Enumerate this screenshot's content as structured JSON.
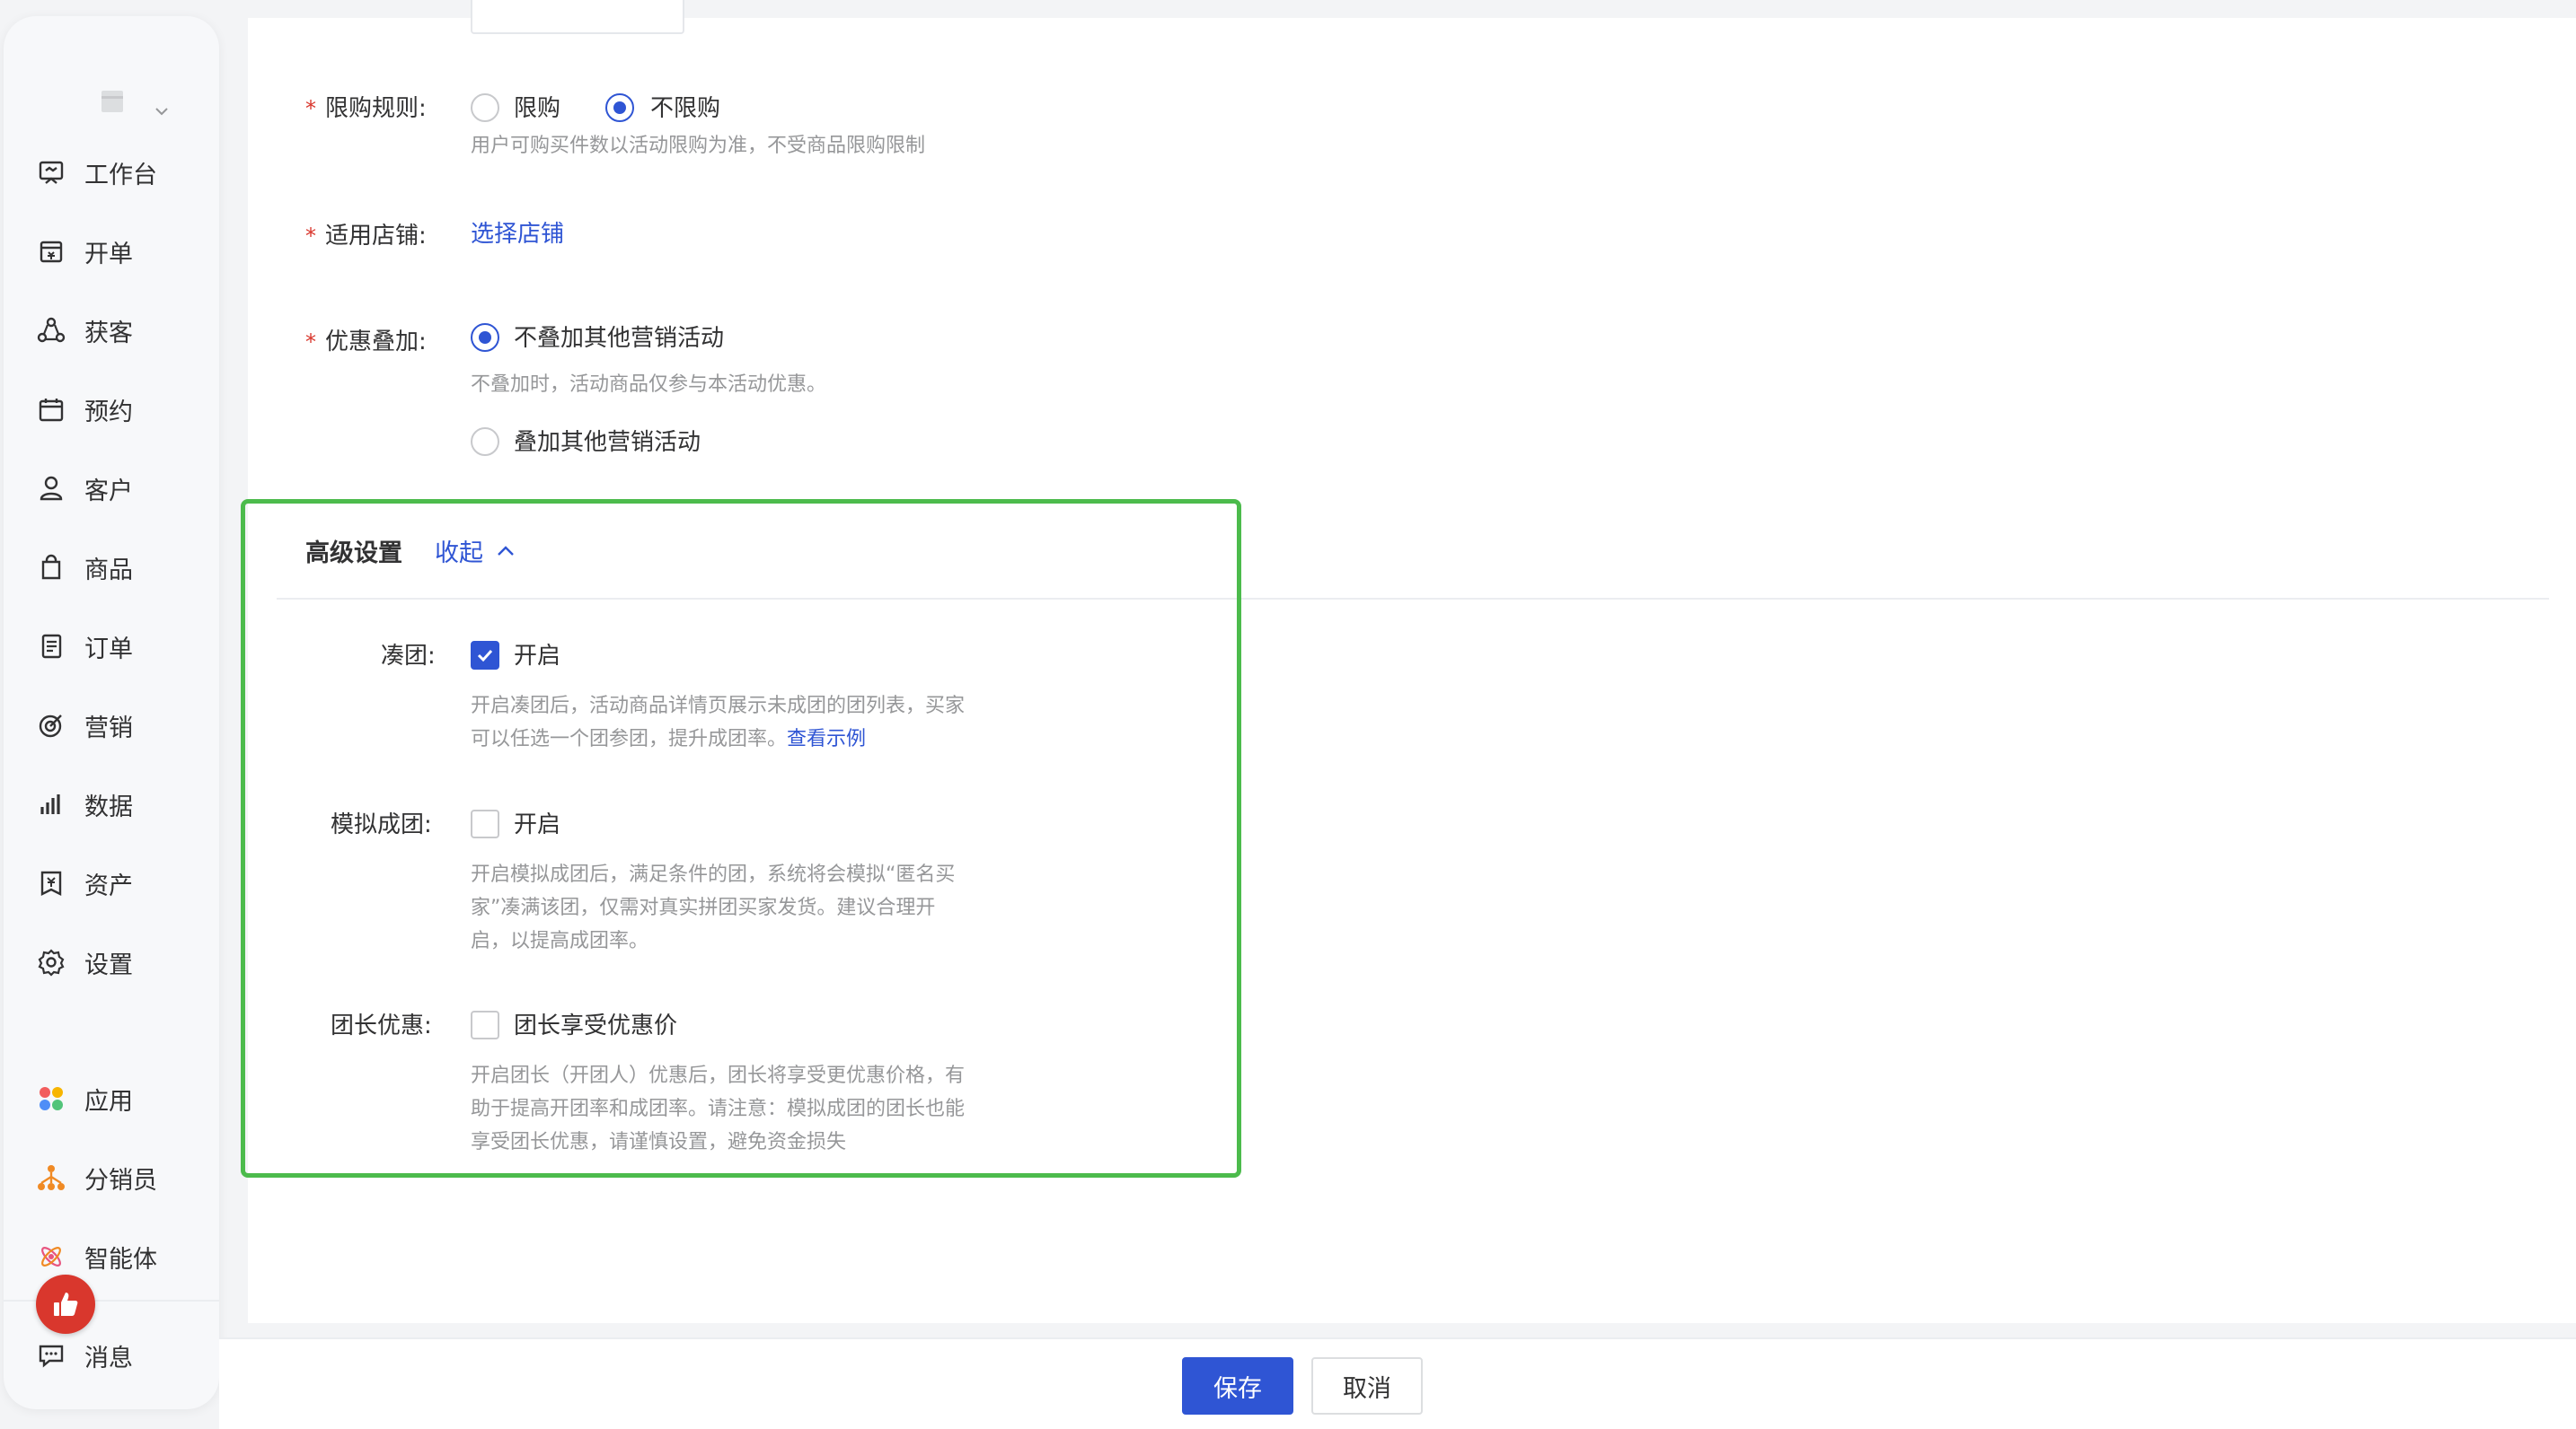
{
  "sidebar": {
    "store_icon": "store-icon",
    "items": [
      {
        "label": "工作台",
        "icon": "workbench-icon"
      },
      {
        "label": "开单",
        "icon": "cashier-icon"
      },
      {
        "label": "获客",
        "icon": "acquire-icon"
      },
      {
        "label": "预约",
        "icon": "calendar-icon"
      },
      {
        "label": "客户",
        "icon": "user-icon"
      },
      {
        "label": "商品",
        "icon": "bag-icon"
      },
      {
        "label": "订单",
        "icon": "order-icon"
      },
      {
        "label": "营销",
        "icon": "marketing-icon"
      },
      {
        "label": "数据",
        "icon": "chart-icon"
      },
      {
        "label": "资产",
        "icon": "asset-icon"
      },
      {
        "label": "设置",
        "icon": "gear-icon"
      },
      {
        "label": "应用",
        "icon": "apps-icon"
      },
      {
        "label": "分销员",
        "icon": "distributor-icon"
      },
      {
        "label": "智能体",
        "icon": "agent-icon"
      },
      {
        "label": "消息",
        "icon": "message-icon"
      }
    ]
  },
  "form": {
    "purchase_limit": {
      "label": "限购规则:",
      "options": [
        "限购",
        "不限购"
      ],
      "selected": "不限购",
      "hint": "用户可购买件数以活动限购为准，不受商品限购限制"
    },
    "stores": {
      "label": "适用店铺:",
      "link": "选择店铺"
    },
    "stacking": {
      "label": "优惠叠加:",
      "options": [
        "不叠加其他营销活动",
        "叠加其他营销活动"
      ],
      "selected": "不叠加其他营销活动",
      "hint": "不叠加时，活动商品仅参与本活动优惠。"
    }
  },
  "advanced": {
    "title": "高级设置",
    "collapse_label": "收起",
    "group_join": {
      "label": "凑团:",
      "checkbox_label": "开启",
      "checked": true,
      "hint_line1": "开启凑团后，活动商品详情页展示未成团的团列表，买家",
      "hint_line2": "可以任选一个团参团，提升成团率。",
      "hint_link": "查看示例"
    },
    "simulate": {
      "label": "模拟成团:",
      "checkbox_label": "开启",
      "checked": false,
      "hint_lines": [
        "开启模拟成团后，满足条件的团，系统将会模拟“匿名买",
        "家”凑满该团，仅需对真实拼团买家发货。建议合理开",
        "启，以提高成团率。"
      ]
    },
    "leader": {
      "label": "团长优惠:",
      "checkbox_label": "团长享受优惠价",
      "checked": false,
      "hint_lines": [
        "开启团长（开团人）优惠后，团长将享受更优惠价格，有",
        "助于提高开团率和成团率。请注意：模拟成团的团长也能",
        "享受团长优惠，请谨慎设置，避免资金损失"
      ]
    }
  },
  "footer": {
    "save_label": "保存",
    "cancel_label": "取消"
  },
  "colors": {
    "accent": "#2f55d4",
    "required": "#d9372d",
    "highlight": "#4cbb4c"
  }
}
